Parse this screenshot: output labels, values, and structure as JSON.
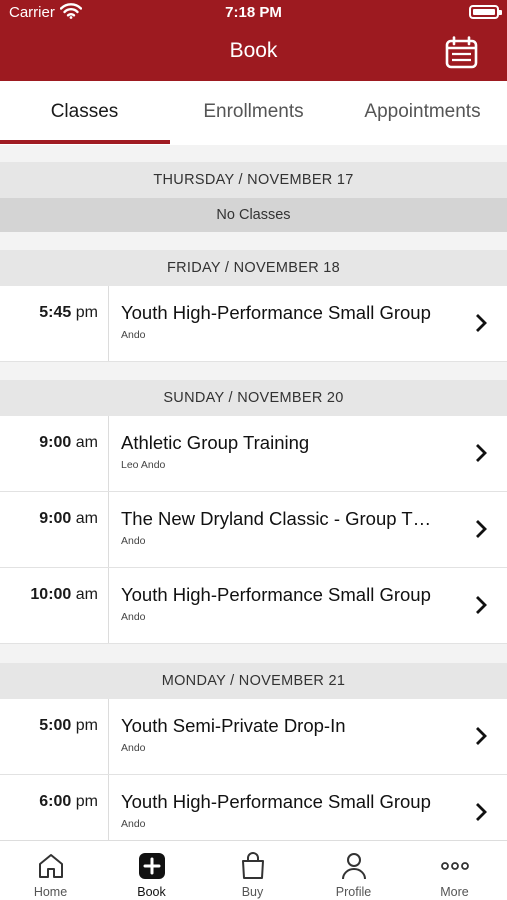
{
  "status_bar": {
    "carrier": "Carrier",
    "time": "7:18 PM"
  },
  "nav": {
    "title": "Book",
    "calendar_icon": "calendar-icon"
  },
  "tabs": [
    {
      "label": "Classes",
      "active": true
    },
    {
      "label": "Enrollments",
      "active": false
    },
    {
      "label": "Appointments",
      "active": false
    }
  ],
  "days": [
    {
      "header": "THURSDAY / NOVEMBER 17",
      "empty_text": "No Classes",
      "classes": []
    },
    {
      "header": "FRIDAY / NOVEMBER 18",
      "classes": [
        {
          "time": "5:45",
          "ampm": "pm",
          "title": "Youth High-Performance Small Group",
          "instructor": "Ando"
        }
      ]
    },
    {
      "header": "SUNDAY / NOVEMBER 20",
      "classes": [
        {
          "time": "9:00",
          "ampm": "am",
          "title": "Athletic Group Training",
          "instructor": "Leo Ando"
        },
        {
          "time": "9:00",
          "ampm": "am",
          "title": "The New Dryland Classic - Group T…",
          "instructor": "Ando"
        },
        {
          "time": "10:00",
          "ampm": "am",
          "title": "Youth High-Performance Small Group",
          "instructor": "Ando"
        }
      ]
    },
    {
      "header": "MONDAY / NOVEMBER 21",
      "classes": [
        {
          "time": "5:00",
          "ampm": "pm",
          "title": "Youth Semi-Private Drop-In",
          "instructor": "Ando"
        },
        {
          "time": "6:00",
          "ampm": "pm",
          "title": "Youth High-Performance Small Group",
          "instructor": "Ando"
        }
      ]
    }
  ],
  "tabbar": [
    {
      "label": "Home",
      "icon": "home-icon"
    },
    {
      "label": "Book",
      "icon": "plus-square-icon",
      "active": true
    },
    {
      "label": "Buy",
      "icon": "shopping-bag-icon"
    },
    {
      "label": "Profile",
      "icon": "person-icon"
    },
    {
      "label": "More",
      "icon": "more-dots-icon"
    }
  ],
  "colors": {
    "brand": "#9d1a20",
    "accent": "#a01c22"
  }
}
